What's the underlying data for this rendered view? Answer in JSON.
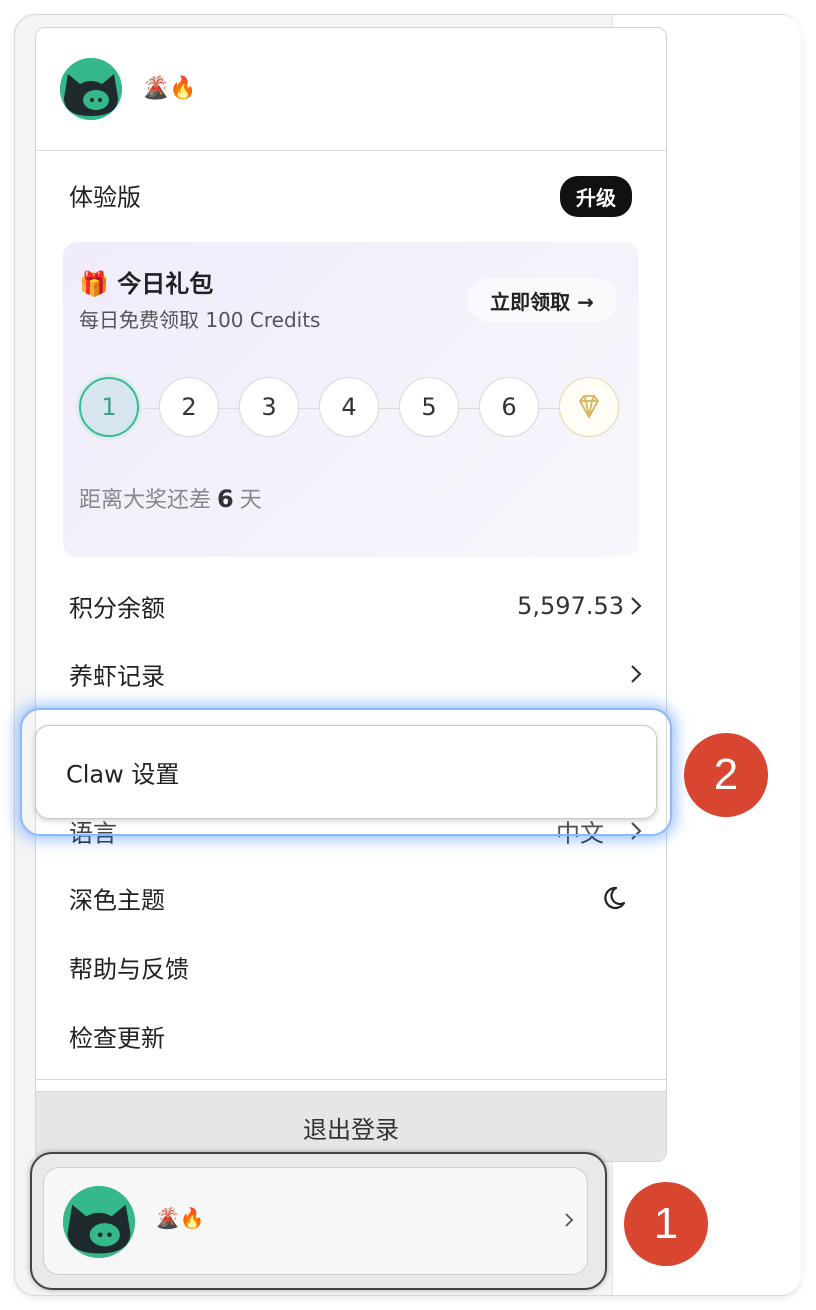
{
  "menu": {
    "username_emoji": "🌋🔥",
    "plan_label": "体验版",
    "upgrade_label": "升级",
    "gift": {
      "icon": "🎁",
      "title": "今日礼包",
      "subtitle": "每日免费领取 100 Credits",
      "claim_label": "立即领取 →",
      "steps": [
        "1",
        "2",
        "3",
        "4",
        "5",
        "6"
      ],
      "active_step": 1,
      "countdown_prefix": "距离大奖还差",
      "countdown_value": "6",
      "countdown_suffix": "天"
    },
    "credits_label": "积分余额",
    "credits_value": "5,597.53",
    "records_label": "养虾记录",
    "claw_settings_label": "Claw 设置",
    "language_label": "语言",
    "language_value": "中文",
    "dark_theme_label": "深色主题",
    "help_label": "帮助与反馈",
    "update_label": "检查更新",
    "logout_label": "退出登录"
  },
  "user_bar": {
    "username_emoji": "🌋🔥"
  },
  "markers": {
    "one": "1",
    "two": "2"
  },
  "colors": {
    "accent_green": "#35b98a",
    "marker_red": "#d84530",
    "highlight_blue": "#8ab8ff"
  }
}
